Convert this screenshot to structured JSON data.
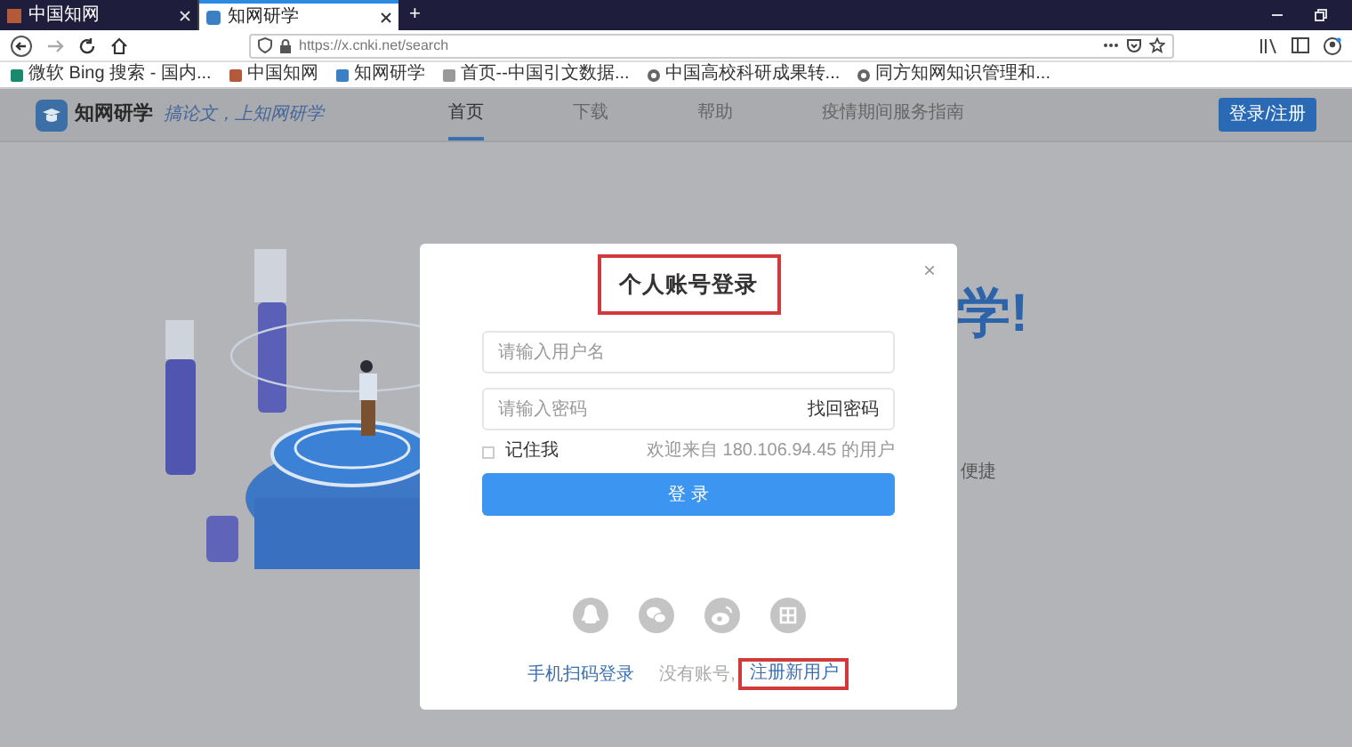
{
  "browser": {
    "tabs": [
      {
        "title": "中国知网",
        "selected": false
      },
      {
        "title": "知网研学",
        "selected": true
      }
    ],
    "new_tab": "+",
    "url": "https://x.cnki.net/search",
    "bookmarks": [
      "微软 Bing 搜索 - 国内...",
      "中国知网",
      "知网研学",
      "首页--中国引文数据...",
      "中国高校科研成果转...",
      "同方知网知识管理和..."
    ]
  },
  "site": {
    "logo_text": "知网研学",
    "slogan": "搞论文，上知网研学",
    "nav": [
      {
        "label": "首页",
        "selected": true
      },
      {
        "label": "下载",
        "selected": false
      },
      {
        "label": "帮助",
        "selected": false
      },
      {
        "label": "疫情期间服务指南",
        "selected": false
      }
    ],
    "login_button": "登录/注册",
    "hero_title": "学!",
    "hero_text": "便捷"
  },
  "dialog": {
    "title": "个人账号登录",
    "title_highlighted": true,
    "close": "×",
    "username": {
      "placeholder": "请输入用户名"
    },
    "password": {
      "placeholder": "请输入密码"
    },
    "forgot_link": "找回密码",
    "remember": {
      "label": "记住我",
      "checked": false
    },
    "welcome": "欢迎来自 180.106.94.45 的用户",
    "submit": "登 录",
    "qr_login": "手机扫码登录",
    "no_account": "没有账号,",
    "register": "注册新用户",
    "register_highlighted": true
  }
}
